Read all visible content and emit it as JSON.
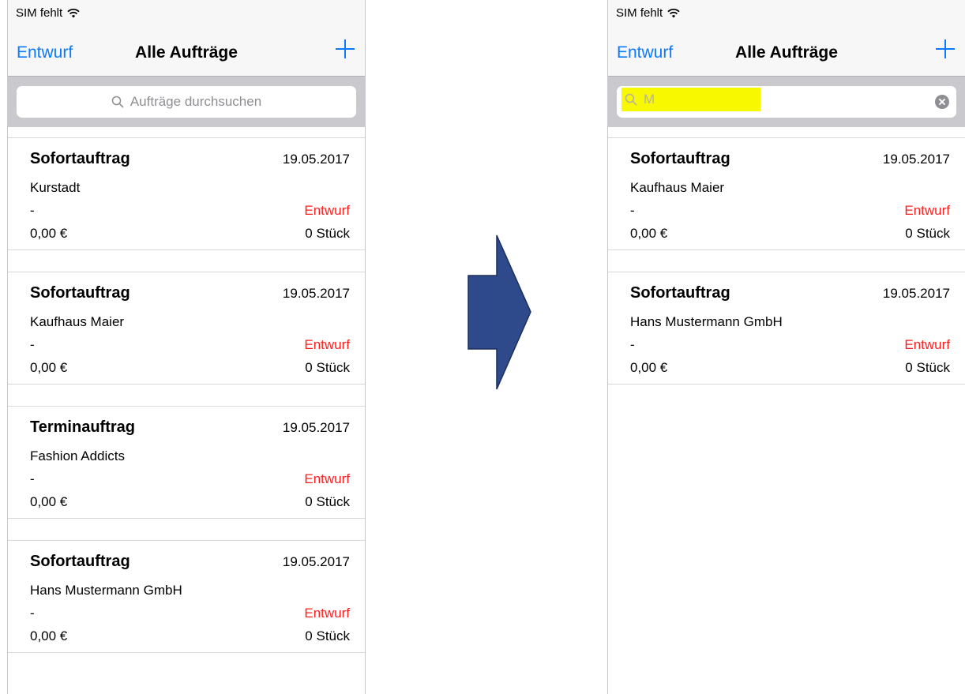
{
  "status_bar": {
    "carrier": "SIM fehlt",
    "wifi_icon": "wifi-icon"
  },
  "nav": {
    "left_label": "Entwurf",
    "title": "Alle Aufträge",
    "add_icon": "plus-icon",
    "accent": "#0a7aff"
  },
  "left_screen": {
    "search_placeholder": "Aufträge durchsuchen",
    "orders": [
      {
        "type": "Sofortauftrag",
        "date": "19.05.2017",
        "customer": "Kurstadt",
        "note": "-",
        "status": "Entwurf",
        "price": "0,00 €",
        "quantity": "0 Stück"
      },
      {
        "type": "Sofortauftrag",
        "date": "19.05.2017",
        "customer": "Kaufhaus Maier",
        "note": "-",
        "status": "Entwurf",
        "price": "0,00 €",
        "quantity": "0 Stück"
      },
      {
        "type": "Terminauftrag",
        "date": "19.05.2017",
        "customer": "Fashion Addicts",
        "note": "-",
        "status": "Entwurf",
        "price": "0,00 €",
        "quantity": "0 Stück"
      },
      {
        "type": "Sofortauftrag",
        "date": "19.05.2017",
        "customer": "Hans Mustermann GmbH",
        "note": "-",
        "status": "Entwurf",
        "price": "0,00 €",
        "quantity": "0 Stück"
      }
    ]
  },
  "right_screen": {
    "search_value": "M",
    "highlight_color": "#f8f800",
    "orders": [
      {
        "type": "Sofortauftrag",
        "date": "19.05.2017",
        "customer": "Kaufhaus Maier",
        "note": "-",
        "status": "Entwurf",
        "price": "0,00 €",
        "quantity": "0 Stück"
      },
      {
        "type": "Sofortauftrag",
        "date": "19.05.2017",
        "customer": "Hans Mustermann GmbH",
        "note": "-",
        "status": "Entwurf",
        "price": "0,00 €",
        "quantity": "0 Stück"
      }
    ]
  },
  "colors": {
    "status_red": "#ff1e1e",
    "arrow_fill": "#2e4a8a"
  }
}
